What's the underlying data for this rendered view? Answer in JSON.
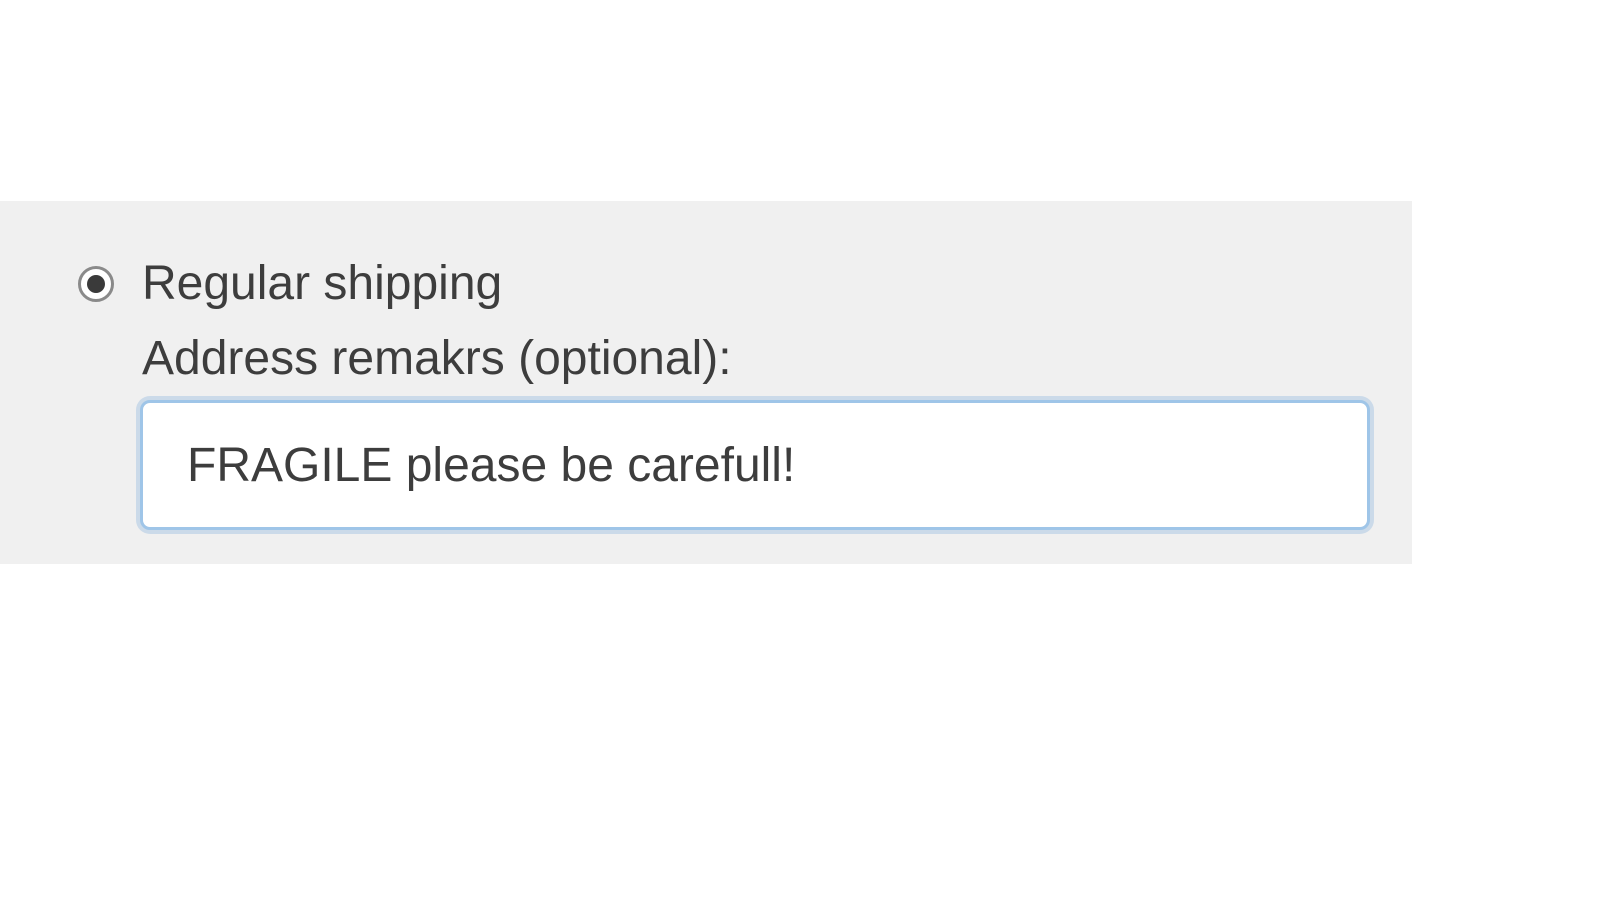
{
  "shipping": {
    "option_regular_label": "Regular shipping",
    "option_regular_selected": true,
    "address_remarks_label": "Address remakrs (optional):",
    "address_remarks_value": "FRAGILE please be carefull!"
  }
}
